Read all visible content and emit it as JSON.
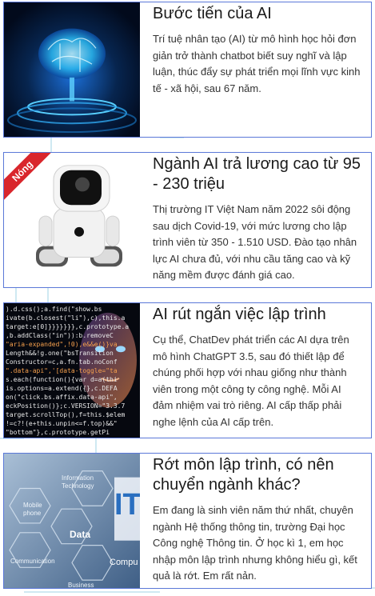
{
  "articles": [
    {
      "title": "Bước tiến của AI",
      "description": "Trí tuệ nhân tạo (AI) từ mô hình học hỏi đơn giản trở thành chatbot biết suy nghĩ và lập luận, thúc đẩy sự phát triển mọi lĩnh vực kinh tế - xã hội, sau 67 năm.",
      "thumbnail": "ai-brain-hologram"
    },
    {
      "title": "Ngành AI trả lương cao từ 95 - 230 triệu",
      "description": "Thị trường IT Việt Nam năm 2022 sôi động sau dịch Covid-19, với mức lương cho lập trình viên từ 350 - 1.510 USD. Đào tạo nhân lực AI chưa đủ, với nhu cầu tăng cao và kỹ năng mềm được đánh giá cao.",
      "badge": "Nóng",
      "thumbnail": "robot-toy"
    },
    {
      "title": "AI rút ngắn việc lập trình",
      "description": "Cụ thể, ChatDev phát triển các AI dựa trên mô hình ChatGPT 3.5, sau đó thiết lập để chúng phối hợp với nhau giống như thành viên trong một công ty công nghệ. Mỗi AI đảm nhiệm vai trò riêng. AI cấp thấp phải nghe lệnh của AI cấp trên.",
      "thumbnail": "code-face"
    },
    {
      "title": "Rớt môn lập trình, có nên chuyển ngành khác?",
      "description": "Em đang là sinh viên năm thứ nhất, chuyên ngành Hệ thống thông tin, trường Đại học Công nghệ Thông tin. Ở học kì 1, em học nhập môn lập trình nhưng không hiểu gì, kết quả là rớt. Em rất nản.",
      "thumbnail": "it-hexagons",
      "thumb_labels": [
        "Information Technology",
        "Mobile phone",
        "Data",
        "Communication",
        "Business",
        "IT",
        "Compu"
      ]
    }
  ],
  "code_lines": [
    ").d.css();a.find(\"show.bs",
    "ivate(b.closest(\"li\"),c),this.a",
    "target:e[0]}}}}}}},c.prototype.a",
    ",b.addClass(\"in\")):b.removeC",
    "\"aria-expanded\",!0),e&&e()}va",
    "Length&&!g.one(\"bsTransition",
    "Constructor=c,a.fn.tab.noConf",
    "\".data-api\",'[data-toggle=\"ta",
    "s.each(function(){var d=a(thi",
    "is.options=a.extend({},c.DEFA",
    "on(\"click.bs.affix.data-api\",",
    "eckPosition()};c.VERSION=\"3.3.7",
    "target.scrollTop(),f=this.$elem",
    "!=c?!(e+this.unpin<=f.top)&&\"",
    "\"bottom\"},c.prototype.getPi"
  ]
}
